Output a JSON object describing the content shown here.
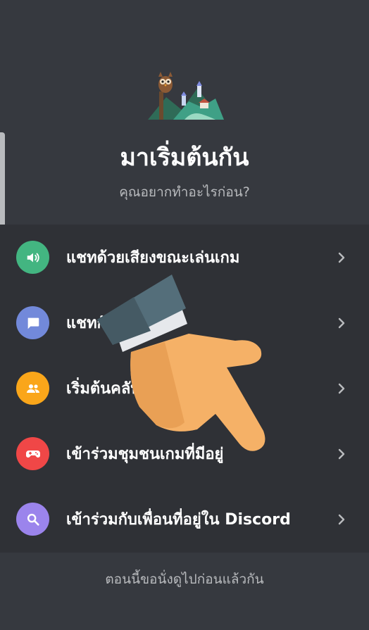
{
  "header": {
    "title": "มาเริ่มต้นกัน",
    "subtitle": "คุณอยากทำอะไรก่อน?"
  },
  "options": [
    {
      "label": "แชทด้วยเสียงขณะเล่นเกม",
      "icon": "speaker-icon",
      "color": "#43b581"
    },
    {
      "label": "แชทกับเพื่อนๆ",
      "icon": "chat-bubble-icon",
      "color": "#7289da"
    },
    {
      "label": "เริ่มต้นคลับ",
      "icon": "people-icon",
      "color": "#faa61a"
    },
    {
      "label": "เข้าร่วมชุมชนเกมที่มีอยู่",
      "icon": "gamepad-icon",
      "color": "#f04747"
    },
    {
      "label": "เข้าร่วมกับเพื่อนที่อยู่ใน Discord",
      "icon": "search-icon",
      "color": "#9b84ec"
    }
  ],
  "footer": {
    "skip_label": "ตอนนี้ขอนั่งดูไปก่อนแล้วกัน"
  },
  "overlay": {
    "icon": "pointing-hand-icon"
  }
}
